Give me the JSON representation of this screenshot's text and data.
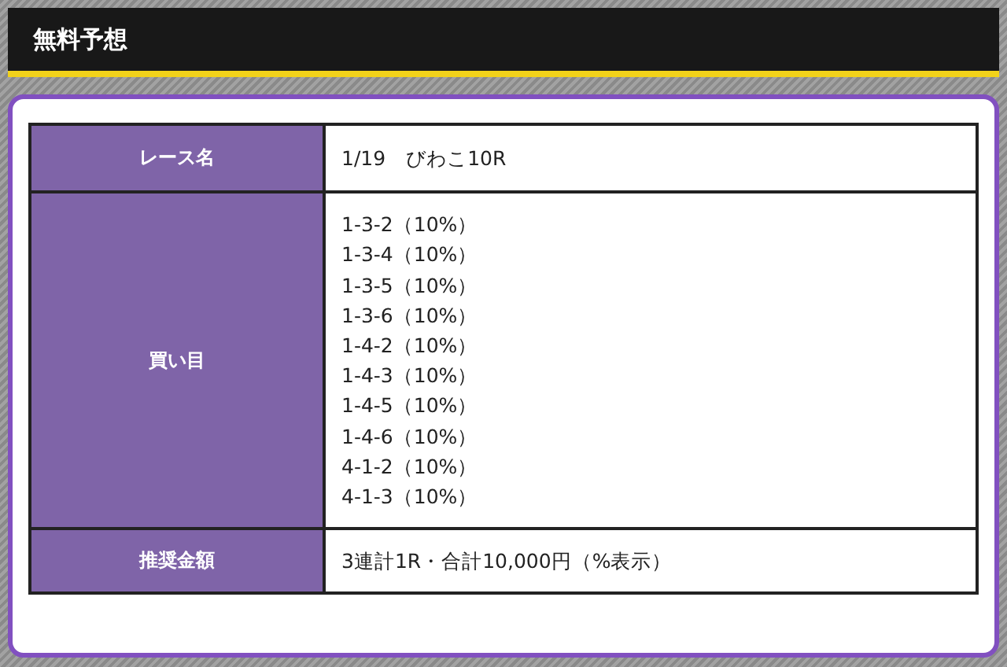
{
  "header": {
    "title": "無料予想"
  },
  "table": {
    "rows": [
      {
        "label": "レース名",
        "values": [
          "1/19　びわこ10R"
        ]
      },
      {
        "label": "買い目",
        "values": [
          "1-3-2（10%）",
          "1-3-4（10%）",
          "1-3-5（10%）",
          "1-3-6（10%）",
          "1-4-2（10%）",
          "1-4-3（10%）",
          "1-4-5（10%）",
          "1-4-6（10%）",
          "4-1-2（10%）",
          "4-1-3（10%）"
        ]
      },
      {
        "label": "推奨金額",
        "values": [
          "3連計1R・合計10,000円（%表示）"
        ]
      }
    ]
  }
}
